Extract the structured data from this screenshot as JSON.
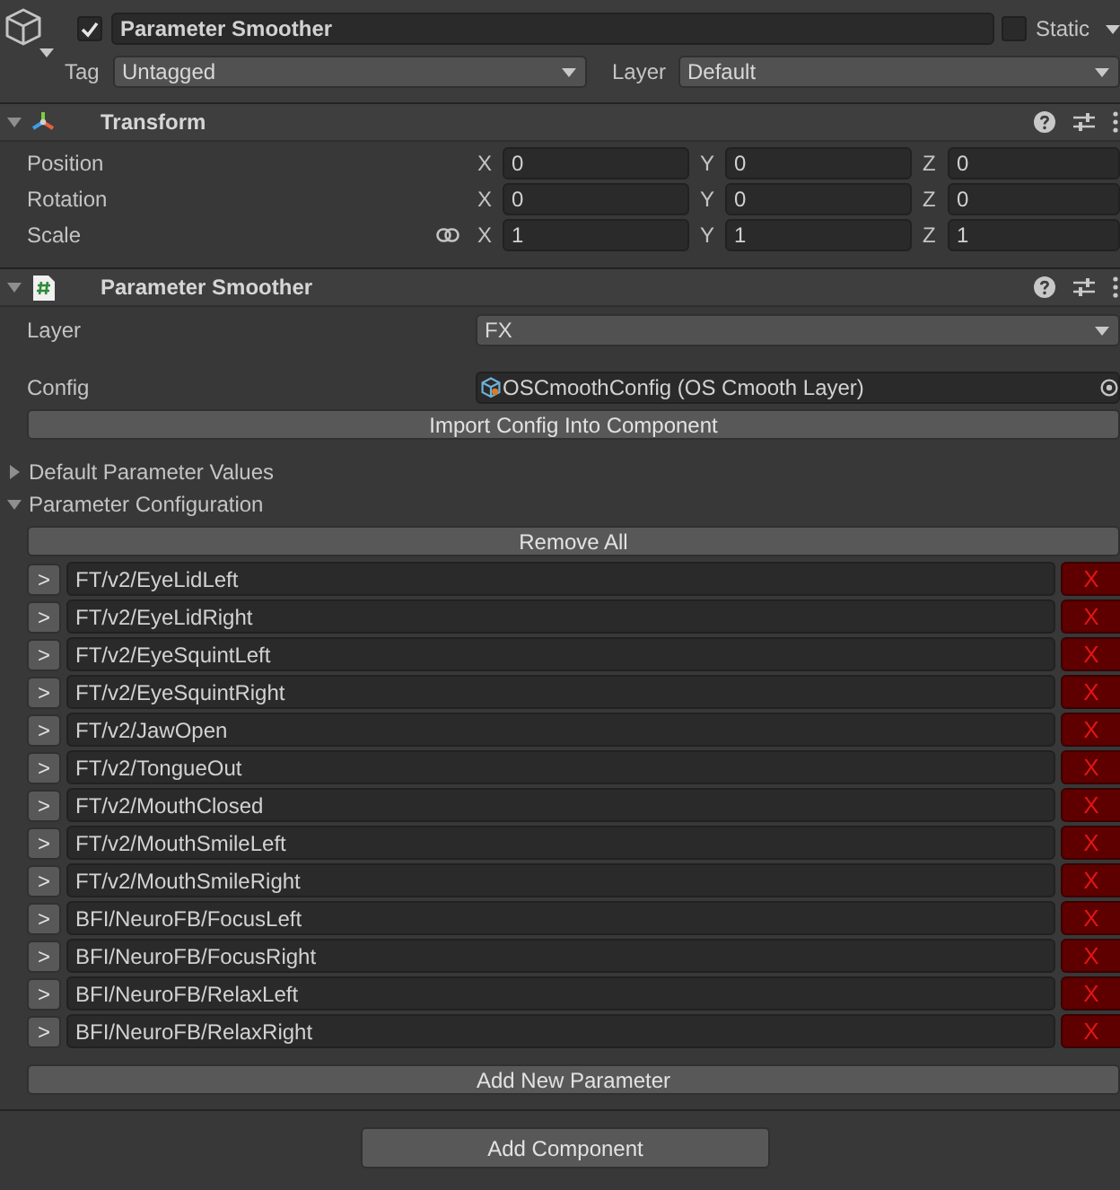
{
  "game_object": {
    "active": true,
    "name": "Parameter Smoother",
    "static": false,
    "static_label": "Static",
    "tag_label": "Tag",
    "tag": "Untagged",
    "layer_label": "Layer",
    "layer": "Default"
  },
  "components": [
    {
      "kind": "transform",
      "title": "Transform",
      "expanded": true,
      "rows": [
        {
          "label": "Position",
          "link_toggle": false,
          "axes": [
            {
              "axis": "X",
              "value": "0"
            },
            {
              "axis": "Y",
              "value": "0"
            },
            {
              "axis": "Z",
              "value": "0"
            }
          ]
        },
        {
          "label": "Rotation",
          "link_toggle": false,
          "axes": [
            {
              "axis": "X",
              "value": "0"
            },
            {
              "axis": "Y",
              "value": "0"
            },
            {
              "axis": "Z",
              "value": "0"
            }
          ]
        },
        {
          "label": "Scale",
          "link_toggle": true,
          "axes": [
            {
              "axis": "X",
              "value": "1"
            },
            {
              "axis": "Y",
              "value": "1"
            },
            {
              "axis": "Z",
              "value": "1"
            }
          ]
        }
      ]
    },
    {
      "kind": "script",
      "title": "Parameter Smoother",
      "expanded": true,
      "layer": {
        "label": "Layer",
        "value": "FX"
      },
      "config": {
        "label": "Config",
        "value": "OSCmoothConfig (OS Cmooth Layer)"
      },
      "import_button": "Import Config Into Component",
      "sections": [
        {
          "label": "Default Parameter Values",
          "expanded": false
        },
        {
          "label": "Parameter Configuration",
          "expanded": true,
          "remove_all_button": "Remove All",
          "parameters": [
            {
              "expand_label": ">",
              "name": "FT/v2/EyeLidLeft",
              "remove_label": "X"
            },
            {
              "expand_label": ">",
              "name": "FT/v2/EyeLidRight",
              "remove_label": "X"
            },
            {
              "expand_label": ">",
              "name": "FT/v2/EyeSquintLeft",
              "remove_label": "X"
            },
            {
              "expand_label": ">",
              "name": "FT/v2/EyeSquintRight",
              "remove_label": "X"
            },
            {
              "expand_label": ">",
              "name": "FT/v2/JawOpen",
              "remove_label": "X"
            },
            {
              "expand_label": ">",
              "name": "FT/v2/TongueOut",
              "remove_label": "X"
            },
            {
              "expand_label": ">",
              "name": "FT/v2/MouthClosed",
              "remove_label": "X"
            },
            {
              "expand_label": ">",
              "name": "FT/v2/MouthSmileLeft",
              "remove_label": "X"
            },
            {
              "expand_label": ">",
              "name": "FT/v2/MouthSmileRight",
              "remove_label": "X"
            },
            {
              "expand_label": ">",
              "name": "BFI/NeuroFB/FocusLeft",
              "remove_label": "X"
            },
            {
              "expand_label": ">",
              "name": "BFI/NeuroFB/FocusRight",
              "remove_label": "X"
            },
            {
              "expand_label": ">",
              "name": "BFI/NeuroFB/RelaxLeft",
              "remove_label": "X"
            },
            {
              "expand_label": ">",
              "name": "BFI/NeuroFB/RelaxRight",
              "remove_label": "X"
            }
          ],
          "add_button": "Add New Parameter"
        }
      ]
    }
  ],
  "add_component_button": "Add Component"
}
